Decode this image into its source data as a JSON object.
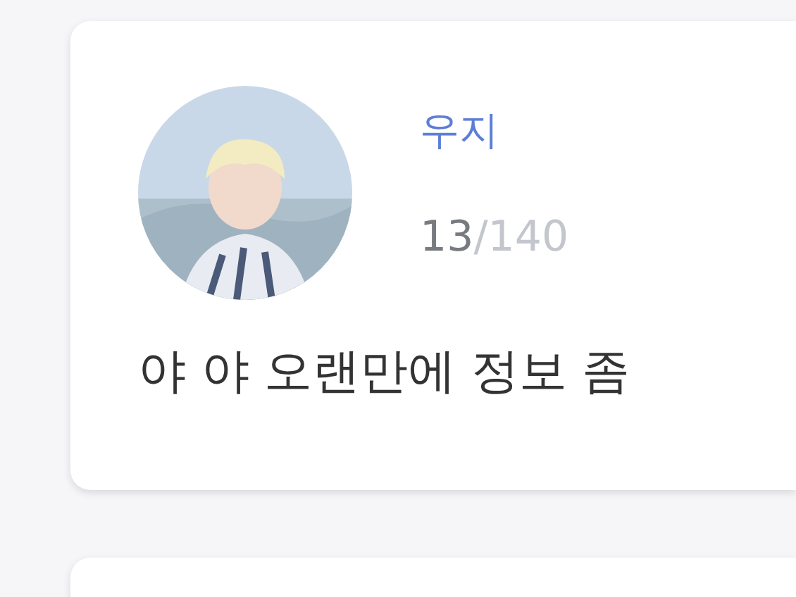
{
  "cards": [
    {
      "kind": "post",
      "name": "우지",
      "counter": {
        "count": "13",
        "limit": "/140"
      },
      "message": "야 야 오랜만에 정보 좀"
    },
    {
      "kind": "empty"
    }
  ]
}
